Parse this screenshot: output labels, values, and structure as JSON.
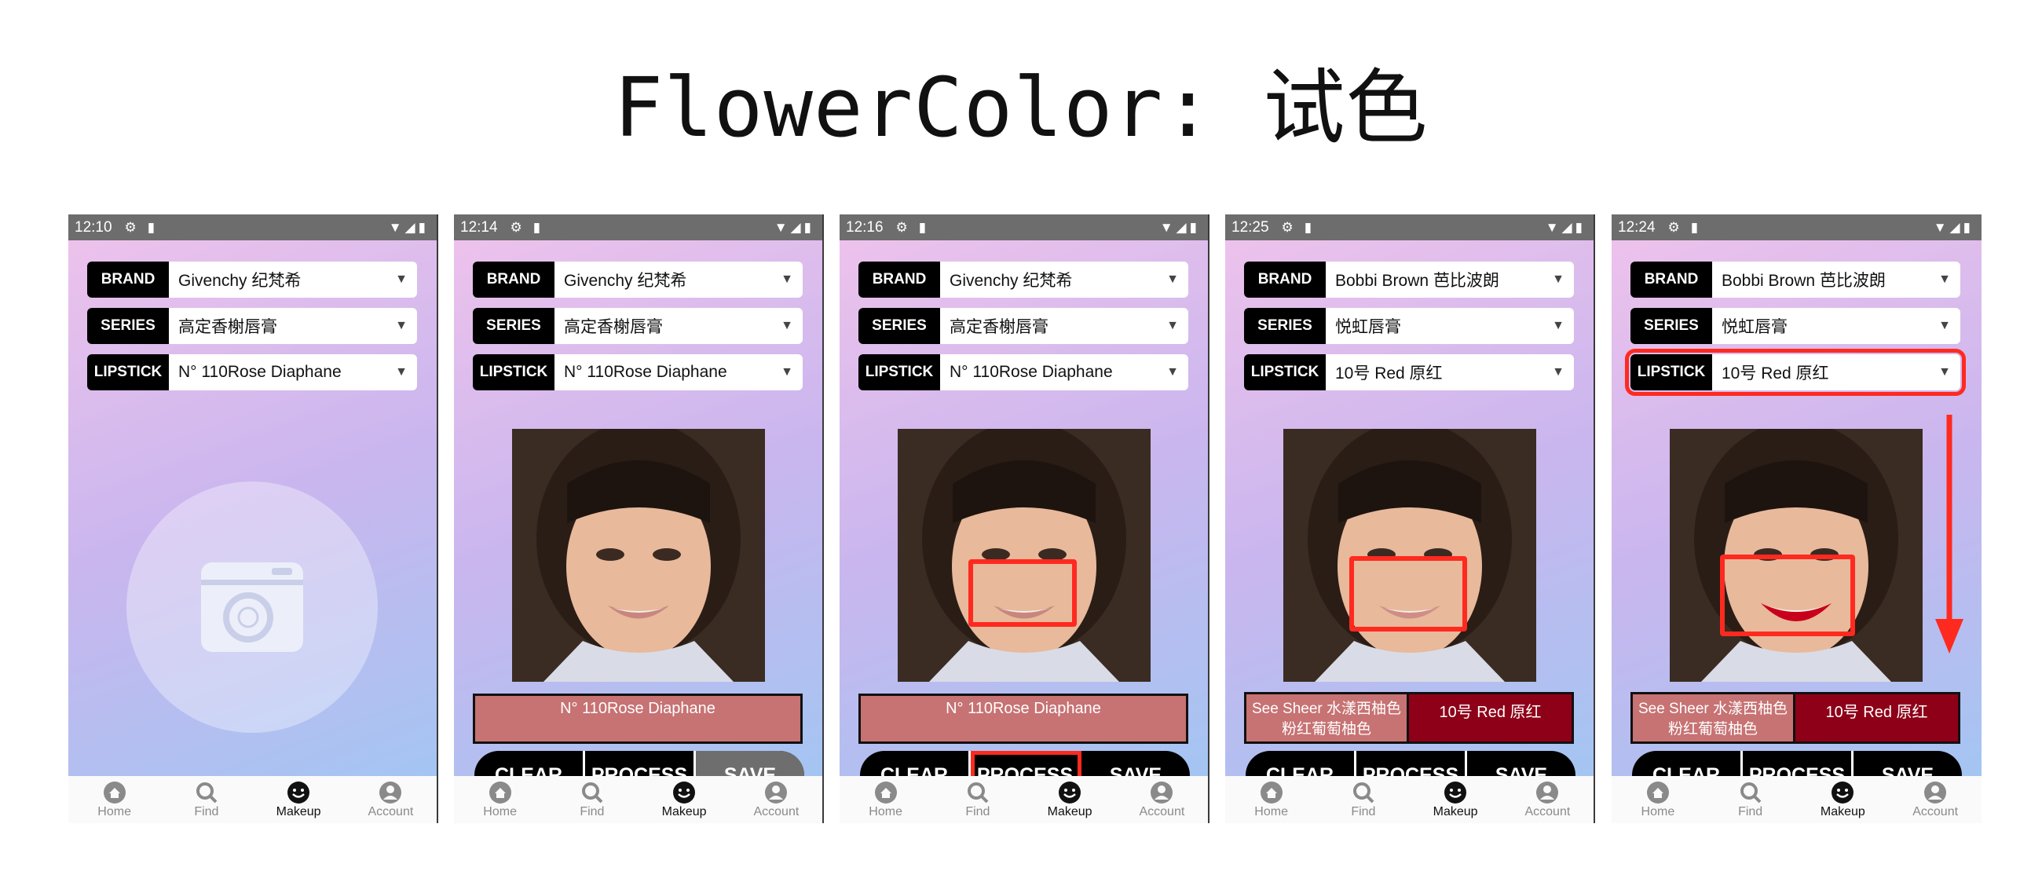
{
  "title": "FlowerColor: 试色",
  "colors": {
    "accent_red": "#ff2a1f",
    "swatch_pink": "#c77273",
    "swatch_red": "#8e0018"
  },
  "row_labels": {
    "brand": "BRAND",
    "series": "SERIES",
    "lipstick": "LIPSTICK"
  },
  "buttons": {
    "clear": "CLEAR",
    "process": "PROCESS",
    "save": "SAVE"
  },
  "nav": {
    "home": "Home",
    "find": "Find",
    "makeup": "Makeup",
    "account": "Account"
  },
  "screens": [
    {
      "time": "12:10",
      "brand": "Givenchy 纪梵希",
      "series": "高定香榭唇膏",
      "lipstick": "N° 110Rose Diaphane"
    },
    {
      "time": "12:14",
      "brand": "Givenchy 纪梵希",
      "series": "高定香榭唇膏",
      "lipstick": "N° 110Rose Diaphane",
      "swatch": "N° 110Rose Diaphane"
    },
    {
      "time": "12:16",
      "brand": "Givenchy 纪梵希",
      "series": "高定香榭唇膏",
      "lipstick": "N° 110Rose Diaphane",
      "swatch": "N° 110Rose Diaphane"
    },
    {
      "time": "12:25",
      "brand": "Bobbi Brown 芭比波朗",
      "series": "悦虹唇膏",
      "lipstick": "10号 Red 原红",
      "swatch_a": "See Sheer 水漾西柚色\n粉红葡萄柚色",
      "swatch_b": "10号 Red 原红"
    },
    {
      "time": "12:24",
      "brand": "Bobbi Brown 芭比波朗",
      "series": "悦虹唇膏",
      "lipstick": "10号 Red 原红",
      "swatch_a": "See Sheer 水漾西柚色\n粉红葡萄柚色",
      "swatch_b": "10号 Red 原红"
    }
  ]
}
